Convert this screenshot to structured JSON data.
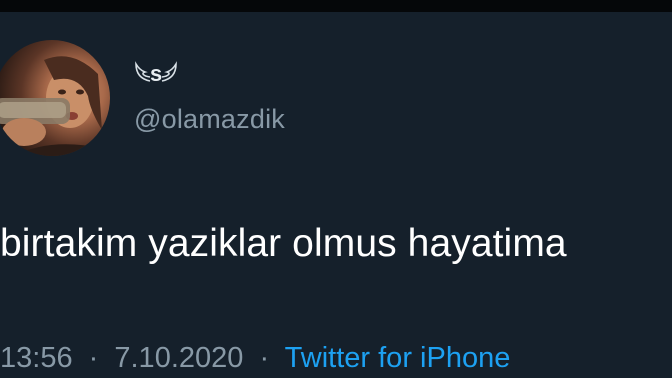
{
  "user": {
    "display_name": "s",
    "handle": "@olamazdik"
  },
  "tweet": {
    "text": "birtakim yaziklar olmus hayatima",
    "time": "13:56",
    "date": "7.10.2020",
    "separator": "·",
    "source": "Twitter for iPhone"
  },
  "colors": {
    "background": "#15202b",
    "text_primary": "#ffffff",
    "text_secondary": "#8899a6",
    "link": "#1da1f2"
  },
  "icons": {
    "left_wing": "wing-left-icon",
    "right_wing": "wing-right-icon"
  }
}
